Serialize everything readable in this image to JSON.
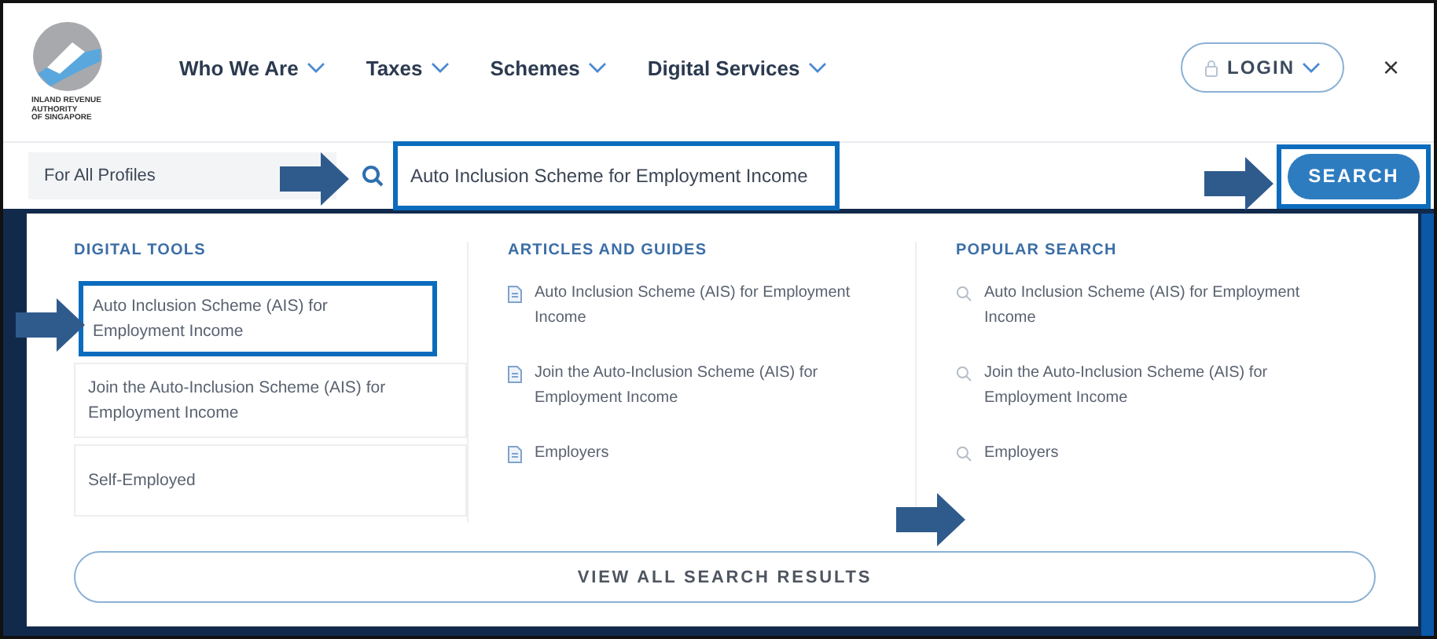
{
  "logo": {
    "lines": [
      "INLAND REVENUE",
      "AUTHORITY",
      "OF SINGAPORE"
    ]
  },
  "nav": [
    {
      "label": "Who We Are"
    },
    {
      "label": "Taxes"
    },
    {
      "label": "Schemes"
    },
    {
      "label": "Digital Services"
    }
  ],
  "login_button": {
    "label": "LOGIN"
  },
  "close_button": {
    "label": "×"
  },
  "search": {
    "profile": "For All Profiles",
    "value": "Auto Inclusion Scheme for Employment Income",
    "highlighted": true,
    "button": "SEARCH",
    "button_highlighted": true
  },
  "digital_tools": {
    "heading": "DIGITAL TOOLS",
    "items": [
      {
        "label": "Auto Inclusion Scheme (AIS) for Employment Income",
        "highlighted": true
      },
      {
        "label": "Join the Auto-Inclusion Scheme (AIS) for Employment Income",
        "highlighted": false
      },
      {
        "label": "Self-Employed",
        "highlighted": false
      }
    ]
  },
  "articles": {
    "heading": "ARTICLES AND GUIDES",
    "items": [
      "Auto Inclusion Scheme (AIS) for Employment Income",
      "Join the Auto-Inclusion Scheme (AIS) for Employment Income",
      "Employers"
    ]
  },
  "popular": {
    "heading": "POPULAR SEARCH",
    "items": [
      "Auto Inclusion Scheme (AIS) for Employment Income",
      "Join the Auto-Inclusion Scheme (AIS) for Employment Income",
      "Employers"
    ]
  },
  "view_all_button": {
    "label": "VIEW ALL SEARCH RESULTS"
  }
}
